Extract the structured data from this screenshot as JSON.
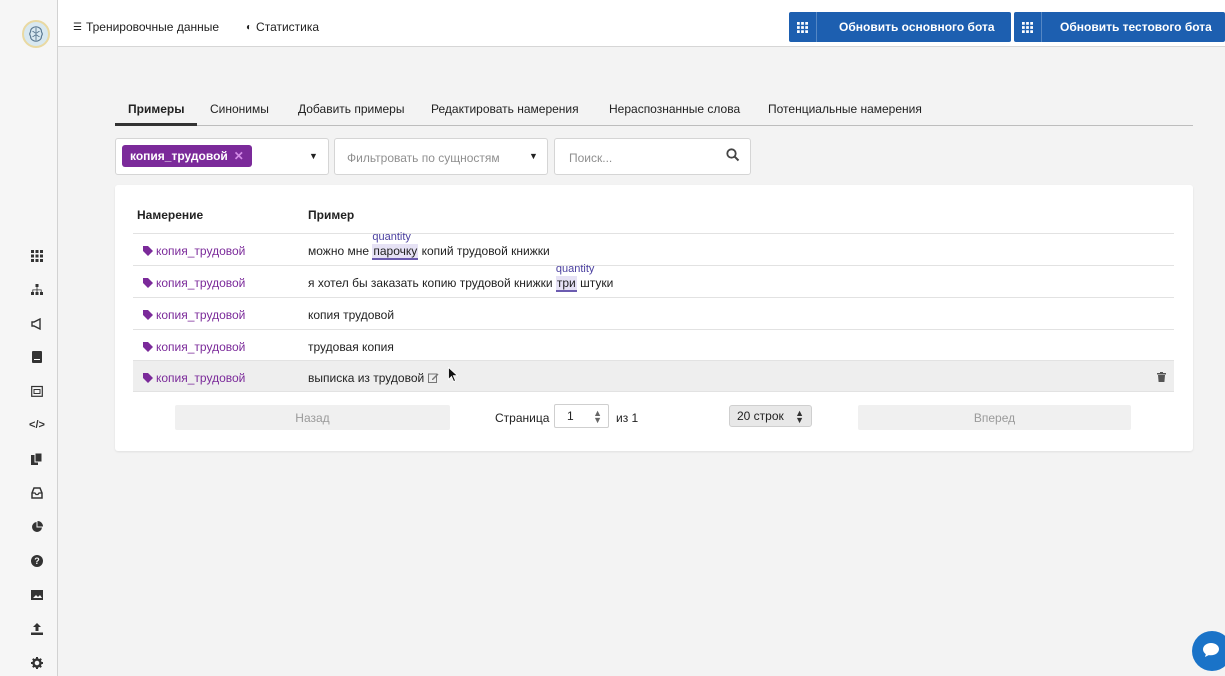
{
  "topnav": {
    "training_data": "Тренировочные данные",
    "statistics": "Статистика"
  },
  "buttons": {
    "update_main_bot": "Обновить основного бота",
    "update_test_bot": "Обновить тестового бота"
  },
  "tabs": [
    {
      "label": "Примеры",
      "active": true
    },
    {
      "label": "Синонимы"
    },
    {
      "label": "Добавить примеры"
    },
    {
      "label": "Редактировать намерения"
    },
    {
      "label": "Нераспознанные слова"
    },
    {
      "label": "Потенциальные намерения"
    }
  ],
  "filters": {
    "intent_chip": "копия_трудовой",
    "entity_placeholder": "Фильтровать по сущностям",
    "search_placeholder": "Поиск..."
  },
  "table": {
    "headers": {
      "intent": "Намерение",
      "example": "Пример"
    },
    "rows": [
      {
        "intent": "копия_трудовой",
        "pre": "можно мне ",
        "entity": "парочку",
        "entity_label": "quantity",
        "post": " копий трудовой книжки"
      },
      {
        "intent": "копия_трудовой",
        "pre": "я хотел бы заказать копию трудовой книжки ",
        "entity": "три",
        "entity_label": "quantity",
        "post": " штуки"
      },
      {
        "intent": "копия_трудовой",
        "text": "копия трудовой"
      },
      {
        "intent": "копия_трудовой",
        "text": "трудовая копия"
      },
      {
        "intent": "копия_трудовой",
        "text": "выписка из трудовой"
      }
    ]
  },
  "pagination": {
    "back": "Назад",
    "page_label": "Страница",
    "page": "1",
    "of": "из 1",
    "rows_per_page": "20 строк",
    "next": "Вперед"
  },
  "colors": {
    "accent_purple": "#7b2a9a",
    "button_blue": "#1d5fb0",
    "entity_underline": "#6b5bb0"
  }
}
